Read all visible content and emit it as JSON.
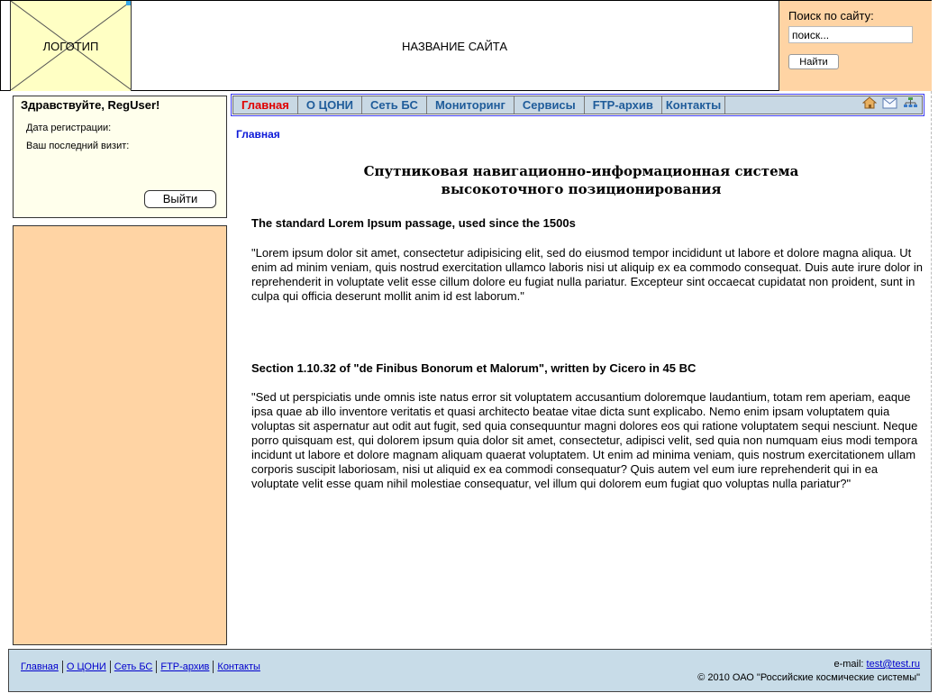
{
  "header": {
    "logo_text": "ЛОГОТИП",
    "site_title": "НАЗВАНИЕ САЙТА",
    "search": {
      "label": "Поиск по сайту:",
      "value": "поиск...",
      "button": "Найти"
    }
  },
  "user_panel": {
    "greeting": "Здравствуйте, RegUser!",
    "reg_date_label": "Дата регистрации:",
    "last_visit_label": "Ваш последний визит:",
    "logout": "Выйти"
  },
  "nav": {
    "items": [
      {
        "label": "Главная",
        "active": true
      },
      {
        "label": "О ЦОНИ",
        "active": false
      },
      {
        "label": "Сеть БС",
        "active": false
      },
      {
        "label": "Мониторинг",
        "active": false
      },
      {
        "label": "Сервисы",
        "active": false
      },
      {
        "label": "FTP-архив",
        "active": false
      },
      {
        "label": "Контакты",
        "active": false
      }
    ],
    "icons": [
      "home-icon",
      "mail-icon",
      "sitemap-icon"
    ]
  },
  "content": {
    "breadcrumb": "Главная",
    "title_line1": "Спутниковая навигационно-информационная система",
    "title_line2": "высокоточного позиционирования",
    "sections": [
      {
        "heading": "The standard Lorem Ipsum passage, used since the 1500s",
        "body": "\"Lorem ipsum dolor sit amet, consectetur adipisicing elit, sed do eiusmod tempor incididunt ut labore et dolore magna aliqua. Ut enim ad minim veniam, quis nostrud exercitation ullamco laboris nisi ut aliquip ex ea commodo consequat. Duis aute irure dolor in reprehenderit in voluptate velit esse cillum dolore eu fugiat nulla pariatur. Excepteur sint occaecat cupidatat non proident, sunt in culpa qui officia deserunt mollit anim id est laborum.\""
      },
      {
        "heading": "Section 1.10.32 of \"de Finibus Bonorum et Malorum\", written by Cicero in 45 BC",
        "body": "\"Sed ut perspiciatis unde omnis iste natus error sit voluptatem accusantium doloremque laudantium, totam rem aperiam, eaque ipsa quae ab illo inventore veritatis et quasi architecto beatae vitae dicta sunt explicabo. Nemo enim ipsam voluptatem quia voluptas sit aspernatur aut odit aut fugit, sed quia consequuntur magni dolores eos qui ratione voluptatem sequi nesciunt. Neque porro quisquam est, qui dolorem ipsum quia dolor sit amet, consectetur, adipisci velit, sed quia non numquam eius modi tempora incidunt ut labore et dolore magnam aliquam quaerat voluptatem. Ut enim ad minima veniam, quis nostrum exercitationem ullam corporis suscipit laboriosam, nisi ut aliquid ex ea commodi consequatur? Quis autem vel eum iure reprehenderit qui in ea voluptate velit esse quam nihil molestiae consequatur, vel illum qui dolorem eum fugiat quo voluptas nulla pariatur?\""
      }
    ]
  },
  "footer": {
    "links": [
      "Главная",
      "О ЦОНИ",
      "Сеть БС",
      "FTP-архив",
      "Контакты"
    ],
    "email_label": "e-mail:",
    "email": "test@test.ru",
    "copyright": "© 2010 ОАО \"Российские космические системы\""
  },
  "colors": {
    "logo_bg": "#ffffc4",
    "search_bg": "#ffd4a4",
    "user_panel_bg": "#ffffec",
    "nav_bg": "#c8d8e4",
    "nav_text": "#1f5c9a",
    "nav_active": "#e00000",
    "breadcrumb": "#0b18d8",
    "footer_bg": "#c8dce8"
  }
}
